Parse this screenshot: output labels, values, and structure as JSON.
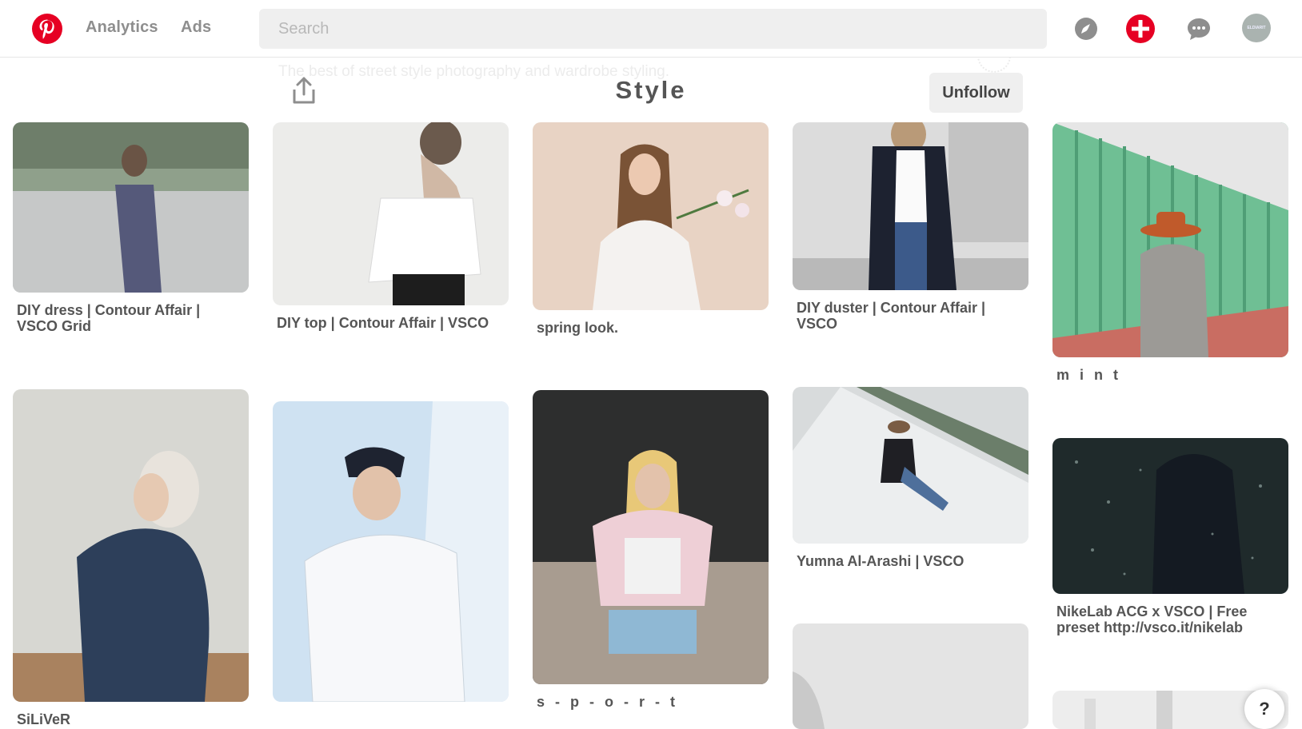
{
  "header": {
    "nav": [
      "Analytics",
      "Ads"
    ],
    "search_placeholder": "Search",
    "avatar_text": "ELDIARIT"
  },
  "board": {
    "title": "Style",
    "description": "The best of street style photography and wardrobe styling.",
    "unfollow_label": "Unfollow"
  },
  "pins": [
    {
      "caption": "DIY dress | Contour Affair | VSCO Grid"
    },
    {
      "caption": "DIY top | Contour Affair | VSCO"
    },
    {
      "caption": "spring look."
    },
    {
      "caption": "DIY duster | Contour Affair | VSCO"
    },
    {
      "caption": "m i n t"
    },
    {
      "caption": "SiLiVeR"
    },
    {
      "caption": ""
    },
    {
      "caption": "s - p - o - r - t"
    },
    {
      "caption": "Yumna Al-Arashi | VSCO"
    },
    {
      "caption": "NikeLab ACG x VSCO | Free preset http://vsco.it/nikelab"
    },
    {
      "caption": ""
    },
    {
      "caption": ""
    }
  ],
  "help_label": "?",
  "colors": {
    "brand": "#e60023",
    "accent_green": "#6fbf94"
  }
}
